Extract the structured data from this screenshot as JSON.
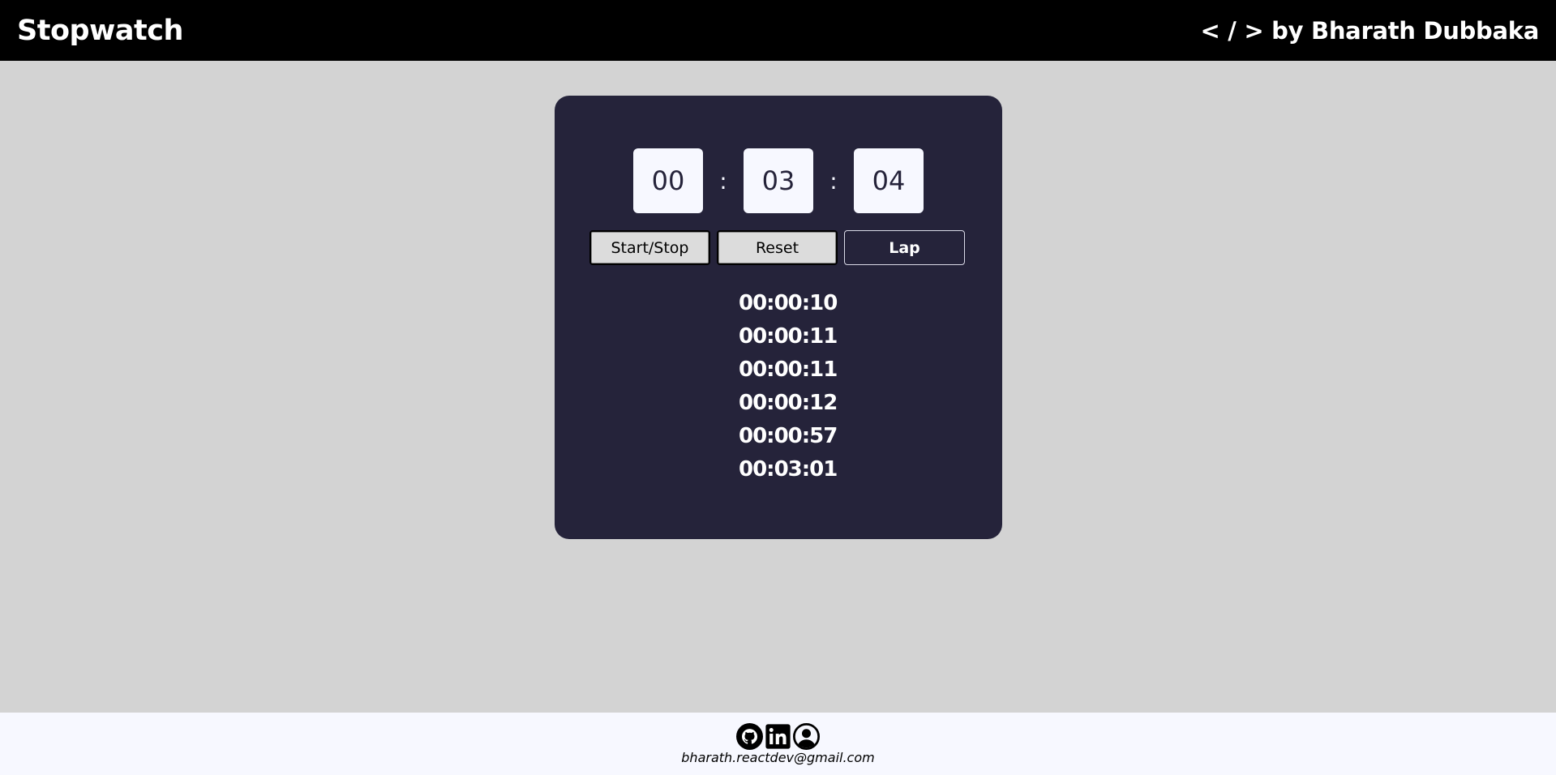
{
  "header": {
    "title": "Stopwatch",
    "author": "< / > by Bharath Dubbaka"
  },
  "timer": {
    "hours": "00",
    "minutes": "03",
    "seconds": "04",
    "separator": ":"
  },
  "controls": {
    "start_stop": "Start/Stop",
    "reset": "Reset",
    "lap": "Lap"
  },
  "laps": [
    "00:00:10",
    "00:00:11",
    "00:00:11",
    "00:00:12",
    "00:00:57",
    "00:03:01"
  ],
  "footer": {
    "icons": [
      "github-icon",
      "linkedin-icon",
      "profile-icon"
    ],
    "email": "bharath.reactdev@gmail.com"
  },
  "colors": {
    "header_bg": "#000000",
    "page_bg": "#d3d3d3",
    "card_bg": "#25233a",
    "footer_bg": "#f7f8ff"
  }
}
